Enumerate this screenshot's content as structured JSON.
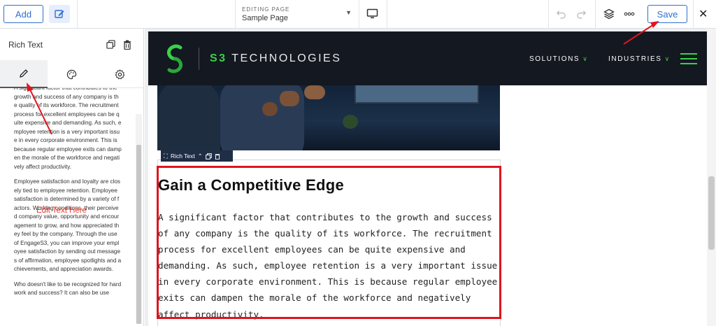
{
  "toolbar": {
    "add_label": "Add",
    "editing_caption": "EDITING PAGE",
    "page_name": "Sample Page",
    "save_label": "Save",
    "icons": [
      "edit-icon",
      "monitor-icon",
      "undo-icon",
      "redo-icon",
      "layers-icon",
      "more-icon",
      "close-icon"
    ]
  },
  "panel": {
    "title": "Rich Text",
    "tabs": [
      "content-tab",
      "style-tab",
      "settings-tab"
    ],
    "paragraphs": [
      "A significant factor that contributes to the growth and success of any company is the quality of its workforce. The recruitment process for excellent employees can be quite expensive and demanding. As such, employee retention is a very important issue in every corporate environment. This is because regular employee exits can dampen the morale of the workforce and negatively affect productivity.",
      "Employee satisfaction and loyalty are closely tied to employee retention. Employee satisfaction is determined by a variety of factors. Working conditions, their perceived company value, opportunity and encouragement to grow, and how appreciated they feel by the company. Through the use of EngageS3, you can improve your employee satisfaction by sending out messages of affirmation, employee spotlights and achievements, and appreciation awards.",
      "Who doesn't like to be recognized for hard work and success? It can also be use"
    ],
    "note": "Edit Text Here"
  },
  "site": {
    "brand_prefix": "S3",
    "brand_rest": "TECHNOLOGIES",
    "nav": [
      "SOLUTIONS",
      "INDUSTRIES"
    ],
    "rich_text_label": "Rich Text",
    "heading": "Gain a Competitive Edge",
    "body": "A significant factor that contributes to the growth and success of any company is the quality of its workforce. The recruitment process for excellent employees can be quite expensive and demanding. As such, employee retention is a very important issue in every corporate environment. This is because regular employee exits can dampen the morale of the workforce and negatively affect productivity."
  },
  "colors": {
    "accent": "#2f6fd0",
    "brand_green": "#3ad24a",
    "annotation_red": "#e0141e"
  }
}
